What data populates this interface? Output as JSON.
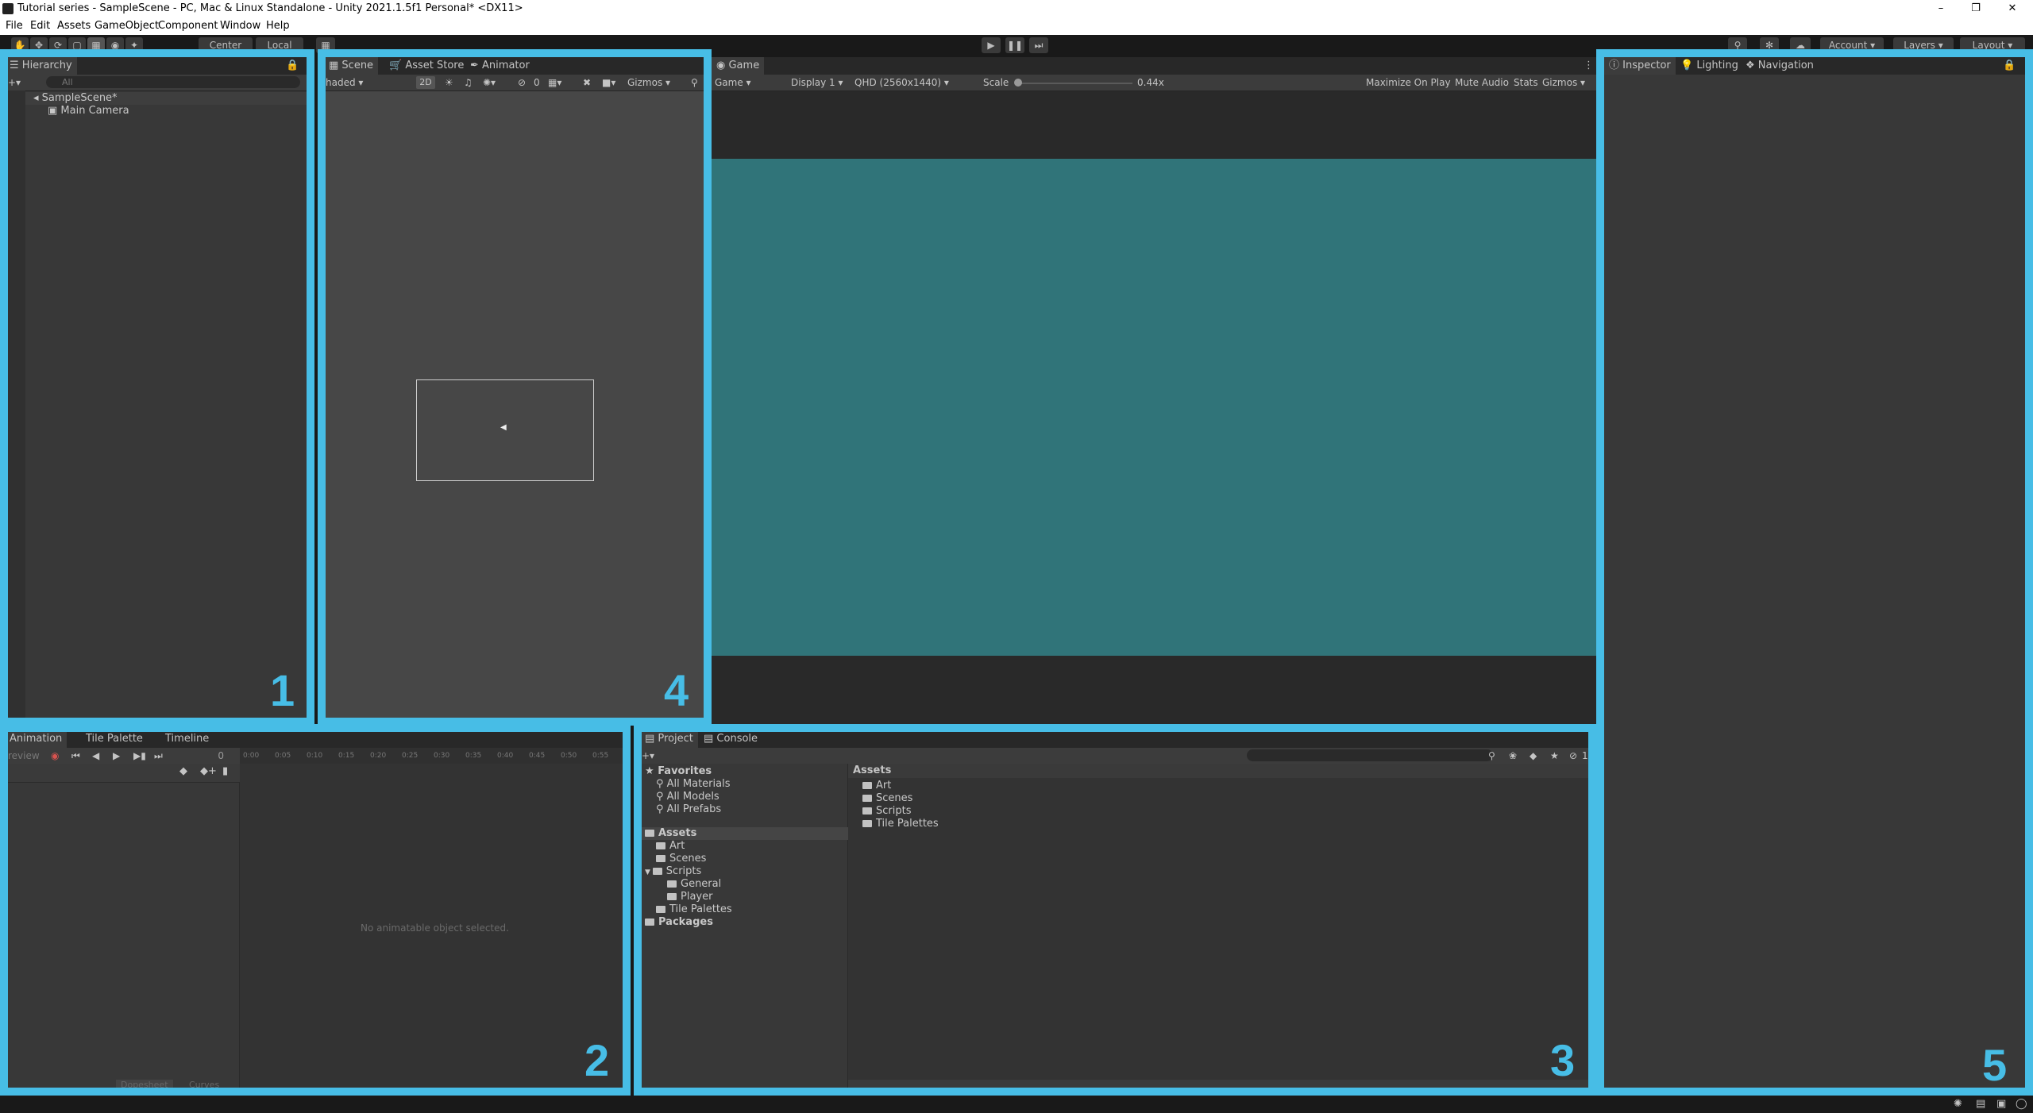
{
  "window": {
    "title": "Tutorial series - SampleScene - PC, Mac & Linux Standalone - Unity 2021.1.5f1 Personal* <DX11>",
    "controls": [
      "–",
      "❐",
      "✕"
    ]
  },
  "menu": [
    "File",
    "Edit",
    "Assets",
    "GameObject",
    "Component",
    "Window",
    "Help"
  ],
  "toolbar": {
    "pivot": "Center",
    "space": "Local",
    "account": "Account",
    "layers": "Layers",
    "layout": "Layout"
  },
  "hierarchy": {
    "tab": "Hierarchy",
    "search_placeholder": "All",
    "scene": "SampleScene*",
    "items": [
      "Main Camera"
    ]
  },
  "scene_panel": {
    "tabs": [
      "Scene",
      "Asset Store",
      "Animator"
    ],
    "shading": "haded",
    "mode_2d": "2D",
    "hidden_count": "0",
    "gizmos": "Gizmos"
  },
  "game_panel": {
    "tab": "Game",
    "view": "Game",
    "display": "Display 1",
    "resolution": "QHD (2560x1440)",
    "scale_label": "Scale",
    "scale_value": "0.44x",
    "maximize": "Maximize On Play",
    "mute": "Mute Audio",
    "stats": "Stats",
    "gizmos": "Gizmos"
  },
  "animation_panel": {
    "tabs": [
      "Animation",
      "Tile Palette",
      "Timeline"
    ],
    "preview": "review",
    "frame": "0",
    "ticks": [
      "0:00",
      "0:05",
      "0:10",
      "0:15",
      "0:20",
      "0:25",
      "0:30",
      "0:35",
      "0:40",
      "0:45",
      "0:50",
      "0:55"
    ],
    "empty": "No animatable object selected.",
    "bottom_tabs": [
      "Dopesheet",
      "Curves"
    ]
  },
  "project_panel": {
    "tabs": [
      "Project",
      "Console"
    ],
    "favorites_label": "Favorites",
    "favorites": [
      "All Materials",
      "All Models",
      "All Prefabs"
    ],
    "assets_label": "Assets",
    "tree": [
      "Art",
      "Scenes",
      "Scripts",
      "General",
      "Player",
      "Tile Palettes"
    ],
    "packages_label": "Packages",
    "breadcrumb": "Assets",
    "contents": [
      "Art",
      "Scenes",
      "Scripts",
      "Tile Palettes"
    ],
    "hidden_count": "1"
  },
  "inspector_panel": {
    "tabs": [
      "Inspector",
      "Lighting",
      "Navigation"
    ]
  },
  "labels": [
    "1",
    "2",
    "3",
    "4",
    "5"
  ],
  "colors": {
    "highlight": "#47bde6",
    "game_bg": "#307479",
    "panel": "#383838"
  }
}
